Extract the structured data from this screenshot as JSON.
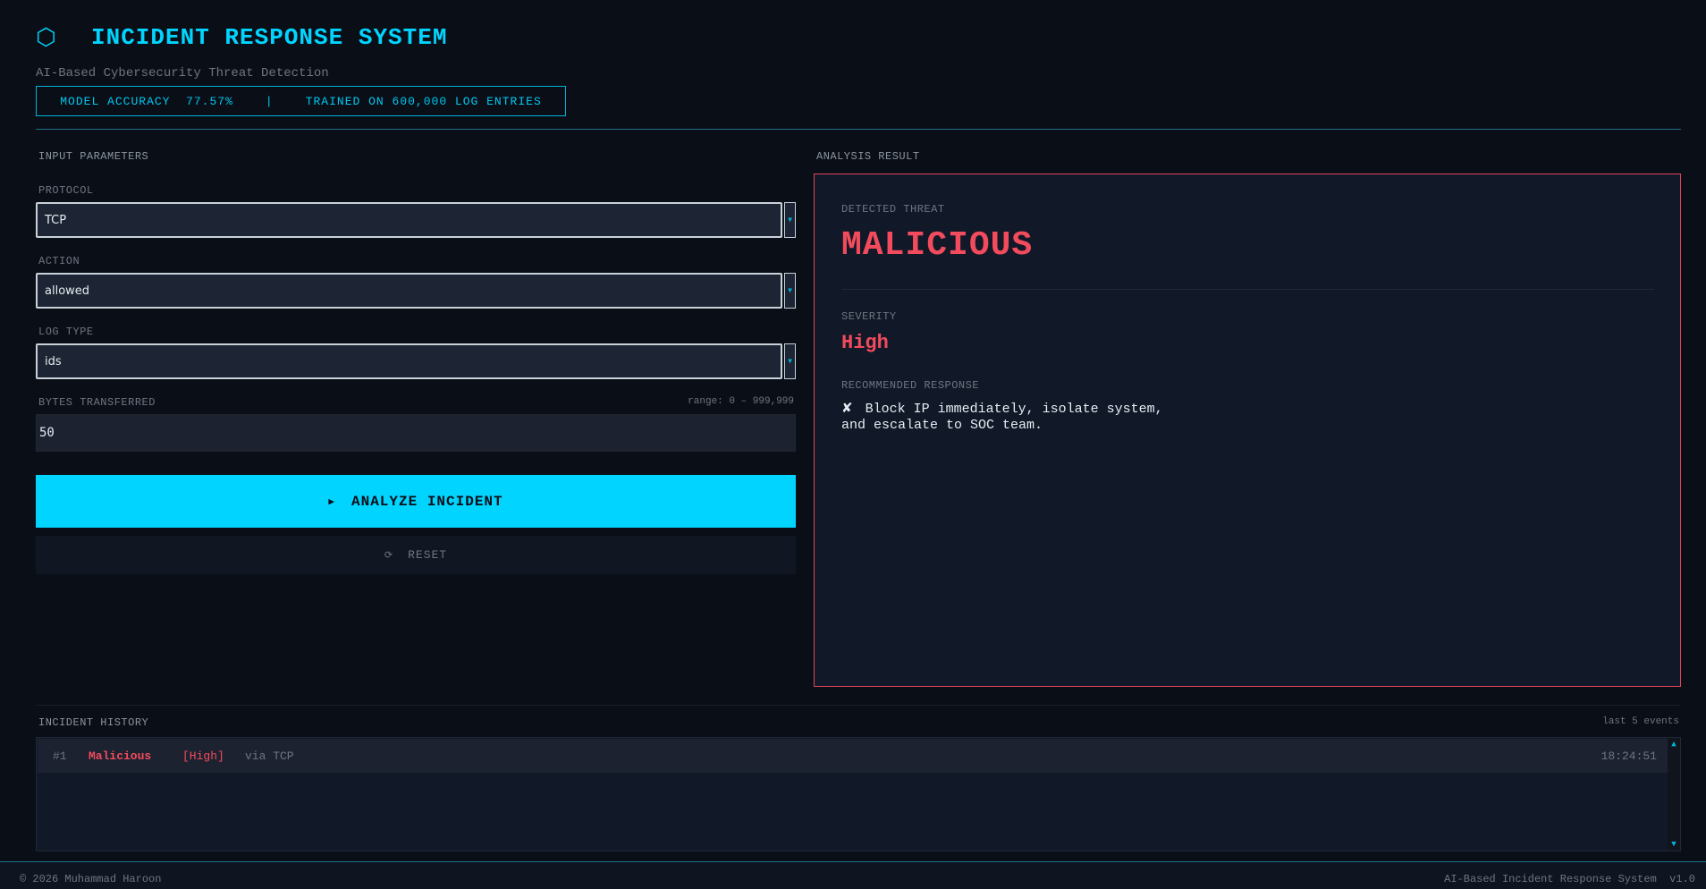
{
  "header": {
    "logo_glyph": "⬡",
    "title": "INCIDENT RESPONSE SYSTEM",
    "subtitle": "AI-Based Cybersecurity Threat Detection",
    "stats": {
      "accuracy": "MODEL ACCURACY  77.57%",
      "separator": "|",
      "trained": "TRAINED ON 600,000 LOG ENTRIES"
    }
  },
  "input_panel": {
    "heading": "INPUT PARAMETERS",
    "protocol": {
      "label": "PROTOCOL",
      "value": "TCP"
    },
    "action": {
      "label": "ACTION",
      "value": "allowed"
    },
    "log_type": {
      "label": "LOG TYPE",
      "value": "ids"
    },
    "bytes": {
      "label": "BYTES TRANSFERRED",
      "range_hint": "range: 0 – 999,999",
      "value": "50"
    },
    "analyze_icon": "▶",
    "analyze_label": "ANALYZE INCIDENT",
    "reset_icon": "⟳",
    "reset_label": "RESET"
  },
  "result_panel": {
    "heading": "ANALYSIS RESULT",
    "threat_label": "DETECTED THREAT",
    "threat_value": "MALICIOUS",
    "severity_label": "SEVERITY",
    "severity_value": "High",
    "response_label": "RECOMMENDED RESPONSE",
    "response_icon": "✘",
    "response_text": "Block IP immediately, isolate system, and escalate to SOC team."
  },
  "history": {
    "heading": "INCIDENT HISTORY",
    "count_hint": "last 5 events",
    "rows": [
      {
        "index": "#1",
        "threat": "Malicious",
        "severity": "[High]",
        "protocol": "via TCP",
        "time": "18:24:51"
      }
    ]
  },
  "footer": {
    "left": "© 2026 Muhammad Haroon",
    "right": "AI-Based Incident Response System  v1.0"
  },
  "colors": {
    "accent": "#00d4ff",
    "danger": "#f24b5d",
    "background": "#0a0e17"
  },
  "icons": {
    "logo": "hexagon-icon",
    "analyze": "play-icon",
    "reset": "refresh-icon",
    "response": "x-mark-icon",
    "select_arrow": "chevron-down-icon"
  }
}
